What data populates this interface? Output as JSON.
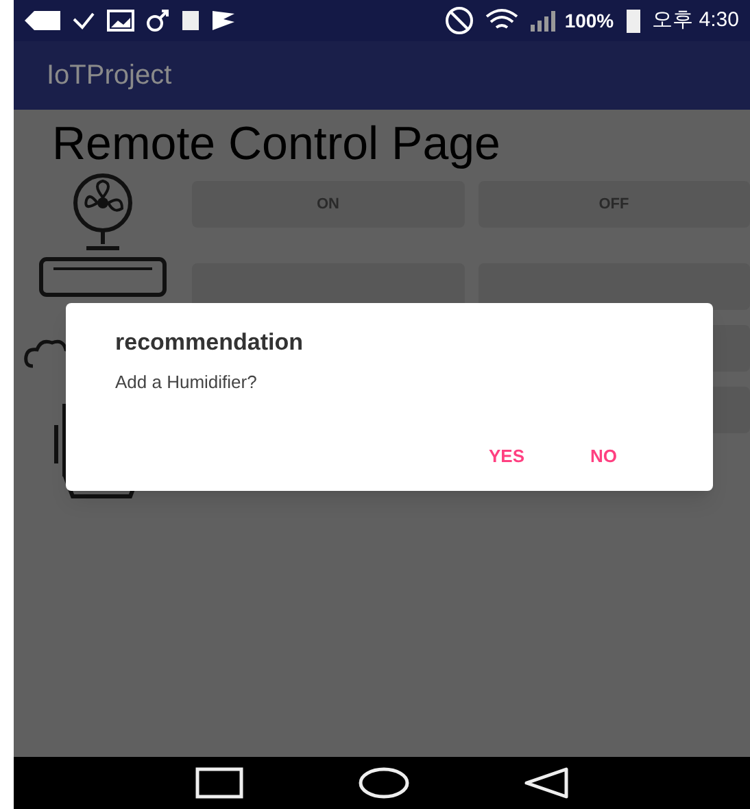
{
  "status_bar": {
    "battery": "100%",
    "time": "오후 4:30"
  },
  "app_bar": {
    "title": "IoTProject"
  },
  "page_title": "Remote Control Page",
  "devices": [
    {
      "kind": "fan",
      "buttons": [
        "ON",
        "OFF"
      ]
    },
    {
      "kind": "aircon"
    },
    {
      "kind": "humidifier"
    },
    {
      "kind": "purifier"
    }
  ],
  "dialog": {
    "title": "recommendation",
    "message": "Add a Humidifier?",
    "actions": [
      "YES",
      "NO"
    ]
  }
}
